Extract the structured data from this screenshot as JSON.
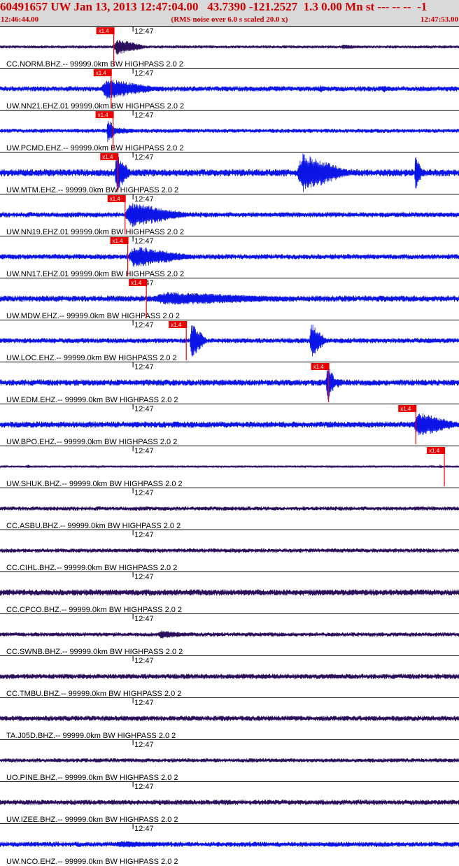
{
  "header": {
    "title": "60491657 UW Jan 13, 2013 12:47:04.00   43.7390 -121.2527  1.3 0.00 Mn st --- -- --  -1",
    "start_time": "12:46:44.00",
    "end_time": "12:47:53.00",
    "note": "(RMS noise over 6.0 s scaled 20.0 x)"
  },
  "chart_data": {
    "type": "line",
    "x_axis": {
      "unit": "s",
      "range": [
        0,
        69
      ],
      "tick_time": 20,
      "tick_label": "12:47"
    },
    "pick_label": "x1.4",
    "colors": {
      "blue": "#0a14e6",
      "dark": "#2b0f5c",
      "pick": "#ee0000",
      "line": "#000000"
    },
    "channels": [
      {
        "label": "CC.NORM.BHZ.-- 99999.0km BW  HIGHPASS  2.0  2",
        "color": "dark",
        "pick": 17.1,
        "noise": 1.5,
        "bursts": [
          [
            17.0,
            5.0,
            12
          ],
          [
            51.0,
            5.0,
            3.5
          ]
        ]
      },
      {
        "label": "UW.NN21.EHZ.01 99999.0km BW  HIGHPASS  2.0  2",
        "color": "blue",
        "pick": 16.7,
        "noise": 2.5,
        "bursts": [
          [
            15.0,
            9.0,
            15
          ],
          [
            48.0,
            1.0,
            6
          ],
          [
            57.5,
            1.0,
            6
          ]
        ]
      },
      {
        "label": "UW.PCMD.EHZ.-- 99999.0km BW  HIGHPASS  2.0  2",
        "color": "blue",
        "pick": 17.0,
        "noise": 2.0,
        "bursts": [
          [
            16.0,
            1.6,
            18
          ],
          [
            17.0,
            5.0,
            5
          ]
        ]
      },
      {
        "label": "UW.MTM.EHZ.-- 99999.0km BW  HIGHPASS  2.0  2",
        "color": "blue",
        "pick": 17.7,
        "noise": 3.5,
        "bursts": [
          [
            17.2,
            2.4,
            28
          ],
          [
            44.5,
            7.8,
            28
          ],
          [
            62.3,
            1.2,
            28
          ]
        ]
      },
      {
        "label": "UW.NN19.EHZ.01 99999.0km BW  HIGHPASS  2.0  2",
        "color": "blue",
        "pick": 18.8,
        "noise": 2.5,
        "bursts": [
          [
            18.5,
            10.0,
            18
          ]
        ]
      },
      {
        "label": "UW.NN17.EHZ.01 99999.0km BW  HIGHPASS  2.0  2",
        "color": "blue",
        "pick": 19.2,
        "noise": 2.5,
        "bursts": [
          [
            19.0,
            10.0,
            16
          ]
        ]
      },
      {
        "label": "UW.MDW.EHZ.-- 99999.0km BW  HIGHPASS  2.0  2",
        "color": "blue",
        "pick": 22.0,
        "noise": 3.0,
        "bursts": [
          [
            22.0,
            25.0,
            10
          ]
        ]
      },
      {
        "label": "UW.LOC.EHZ.-- 99999.0km BW  HIGHPASS  2.0  2",
        "color": "blue",
        "pick": 28.0,
        "noise": 2.5,
        "bursts": [
          [
            28.5,
            2.5,
            26
          ],
          [
            46.5,
            2.5,
            26
          ]
        ]
      },
      {
        "label": "UW.EDM.EHZ.-- 99999.0km BW  HIGHPASS  2.0  2",
        "color": "blue",
        "pick": 49.4,
        "noise": 3.0,
        "bursts": [
          [
            49.0,
            1.5,
            28
          ],
          [
            50.5,
            1.5,
            8
          ]
        ]
      },
      {
        "label": "UW.BPO.EHZ.-- 99999.0km BW  HIGHPASS  2.0  2",
        "color": "blue",
        "pick": 62.5,
        "noise": 3.0,
        "bursts": [
          [
            62.0,
            7.0,
            18
          ]
        ]
      },
      {
        "label": "UW.SHUK.BHZ.-- 99999.0km BW  HIGHPASS  2.0  2",
        "color": "dark",
        "pick": 66.8,
        "noise": 1.0,
        "bursts": [
          [
            4.0,
            1.0,
            3
          ],
          [
            66.0,
            0.8,
            3
          ]
        ]
      },
      {
        "label": "CC.ASBU.BHZ.-- 99999.0km BW  HIGHPASS  2.0  2",
        "color": "dark",
        "noise": 2.0,
        "bursts": []
      },
      {
        "label": "CC.CIHL.BHZ.-- 99999.0km BW  HIGHPASS  2.0  2",
        "color": "dark",
        "noise": 2.0,
        "bursts": []
      },
      {
        "label": "CC.CPCO.BHZ.-- 99999.0km BW  HIGHPASS  2.0  2",
        "color": "dark",
        "noise": 3.0,
        "bursts": []
      },
      {
        "label": "CC.SWNB.BHZ.-- 99999.0km BW  HIGHPASS  2.0  2",
        "color": "dark",
        "noise": 2.0,
        "bursts": [
          [
            23.5,
            6.0,
            6
          ]
        ]
      },
      {
        "label": "CC.TMBU.BHZ.-- 99999.0km BW  HIGHPASS  2.0  2",
        "color": "dark",
        "noise": 2.5,
        "bursts": []
      },
      {
        "label": "TA.J05D.BHZ.-- 99999.0km BW  HIGHPASS  2.0  2",
        "color": "dark",
        "noise": 2.5,
        "bursts": []
      },
      {
        "label": "UO.PINE.BHZ.-- 99999.0km BW  HIGHPASS  2.0  2",
        "color": "dark",
        "noise": 2.0,
        "bursts": []
      },
      {
        "label": "UW.IZEE.BHZ.-- 99999.0km BW  HIGHPASS  2.0  2",
        "color": "dark",
        "noise": 2.5,
        "bursts": []
      },
      {
        "label": "UW.NCO.EHZ.-- 99999.0km BW  HIGHPASS  2.0  2",
        "color": "blue",
        "noise": 2.5,
        "bursts": [
          [
            17.0,
            10.0,
            5
          ]
        ]
      }
    ]
  }
}
